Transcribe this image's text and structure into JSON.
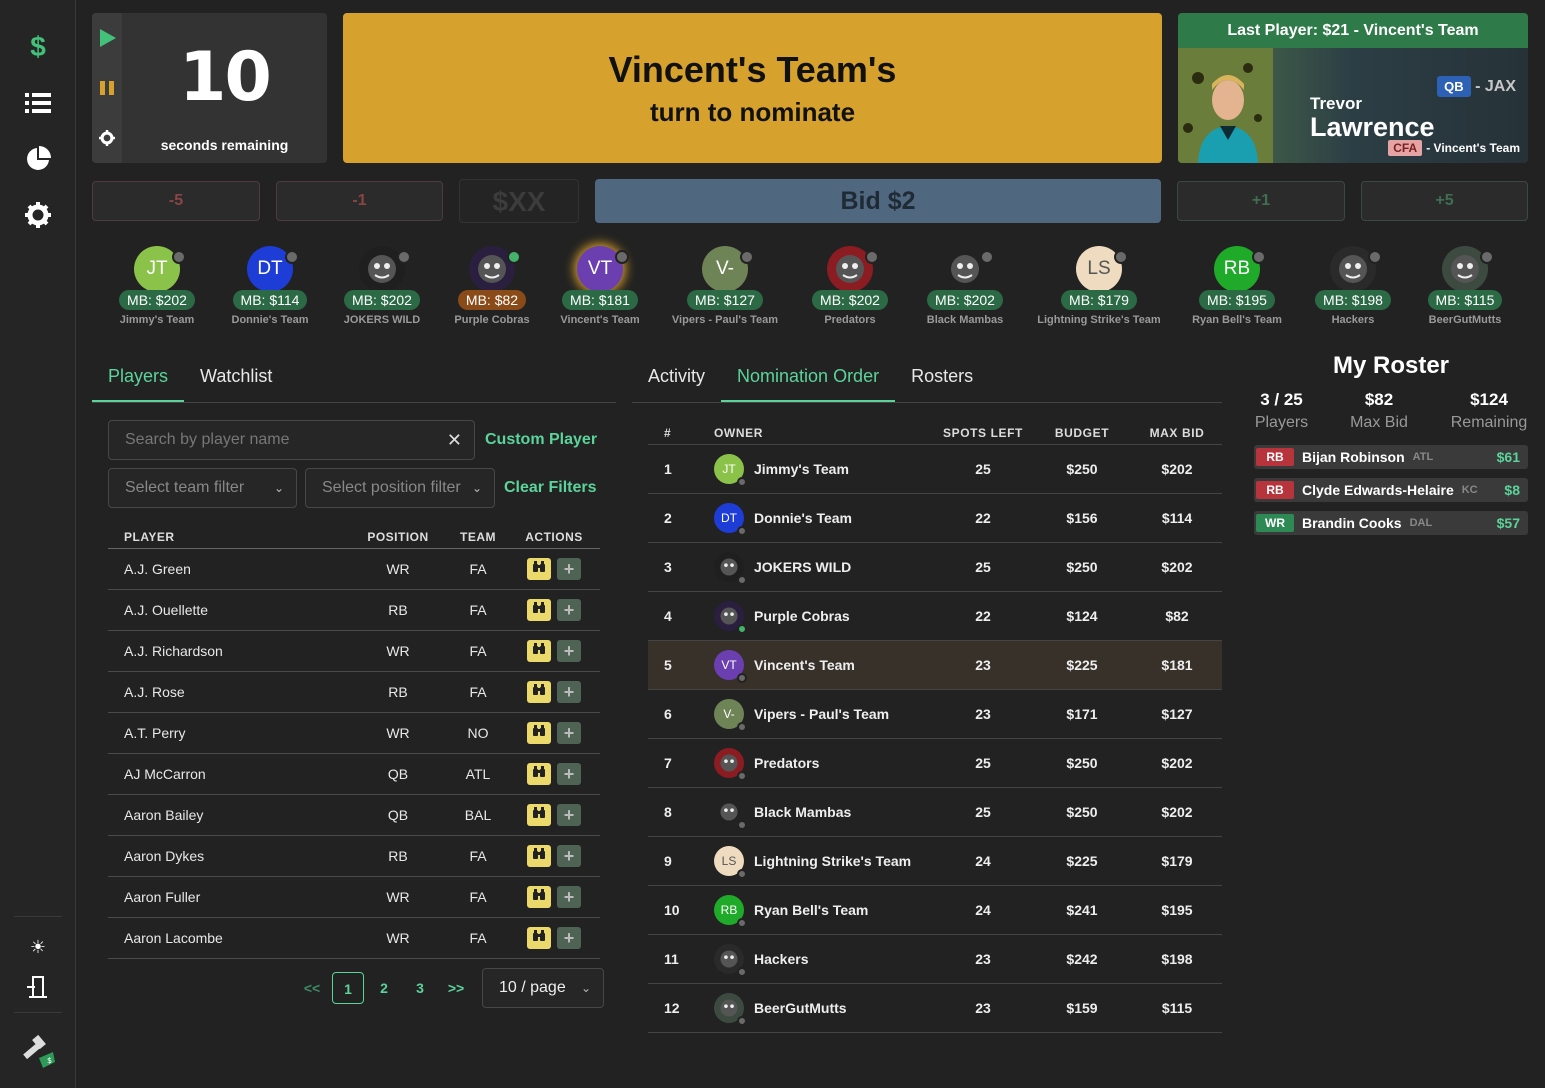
{
  "timer": {
    "value": "10",
    "label": "seconds remaining"
  },
  "banner": {
    "title": "Vincent's Team's",
    "subtitle": "turn to nominate"
  },
  "last_player": {
    "header": "Last Player: $21 - Vincent's Team",
    "position": "QB",
    "team": "- JAX",
    "first_name": "Trevor",
    "last_name": "Lawrence",
    "status": "CFA",
    "owner": "- Vincent's Team"
  },
  "bid": {
    "minus5": "-5",
    "minus1": "-1",
    "input_placeholder": "$XX",
    "main": "Bid $2",
    "plus1": "+1",
    "plus5": "+5"
  },
  "teams": [
    {
      "initials": "JT",
      "mb": "MB: $202",
      "name": "Jimmy's Team",
      "color": "#8bc34a",
      "online": false
    },
    {
      "initials": "DT",
      "mb": "MB: $114",
      "name": "Donnie's Team",
      "color": "#1e3cd6",
      "online": false
    },
    {
      "initials": "",
      "mb": "MB: $202",
      "name": "JOKERS WILD",
      "color": "#1f1f1f",
      "online": false,
      "icon": "joker-logo-icon"
    },
    {
      "initials": "",
      "mb": "MB: $82",
      "name": "Purple Cobras",
      "color": "#2a1f3f",
      "online": true,
      "warn": true,
      "icon": "cobra-logo-icon"
    },
    {
      "initials": "VT",
      "mb": "MB: $181",
      "name": "Vincent's Team",
      "color": "#6b3fb0",
      "online": false,
      "current": true
    },
    {
      "initials": "V-",
      "mb": "MB: $127",
      "name": "Vipers - Paul's Team",
      "color": "#6f8456",
      "online": false
    },
    {
      "initials": "",
      "mb": "MB: $202",
      "name": "Predators",
      "color": "#8a1c22",
      "online": false,
      "icon": "predator-logo-icon"
    },
    {
      "initials": "",
      "mb": "MB: $202",
      "name": "Black Mambas",
      "color": "#222222",
      "online": false,
      "icon": "mamba-logo-icon"
    },
    {
      "initials": "LS",
      "mb": "MB: $179",
      "name": "Lightning Strike's Team",
      "color": "#efdcc0",
      "online": false,
      "dark_text": true
    },
    {
      "initials": "RB",
      "mb": "MB: $195",
      "name": "Ryan Bell's Team",
      "color": "#1faa2a",
      "online": false
    },
    {
      "initials": "",
      "mb": "MB: $198",
      "name": "Hackers",
      "color": "#2a2a2a",
      "online": false,
      "icon": "skull-logo-icon"
    },
    {
      "initials": "",
      "mb": "MB: $115",
      "name": "BeerGutMutts",
      "color": "#3c4a40",
      "online": false,
      "icon": "bulldog-logo-icon"
    }
  ],
  "left_tabs": [
    "Players",
    "Watchlist"
  ],
  "search": {
    "placeholder": "Search by player name",
    "custom_player": "Custom Player"
  },
  "filters": {
    "team": "Select team filter",
    "position": "Select position filter",
    "clear": "Clear Filters"
  },
  "players_table": {
    "headers": [
      "PLAYER",
      "POSITION",
      "TEAM",
      "ACTIONS"
    ],
    "rows": [
      [
        "A.J. Green",
        "WR",
        "FA"
      ],
      [
        "A.J. Ouellette",
        "RB",
        "FA"
      ],
      [
        "A.J. Richardson",
        "WR",
        "FA"
      ],
      [
        "A.J. Rose",
        "RB",
        "FA"
      ],
      [
        "A.T. Perry",
        "WR",
        "NO"
      ],
      [
        "AJ McCarron",
        "QB",
        "ATL"
      ],
      [
        "Aaron Bailey",
        "QB",
        "BAL"
      ],
      [
        "Aaron Dykes",
        "RB",
        "FA"
      ],
      [
        "Aaron Fuller",
        "WR",
        "FA"
      ],
      [
        "Aaron Lacombe",
        "WR",
        "FA"
      ]
    ]
  },
  "pagination": {
    "prev": "<<",
    "pages": [
      "1",
      "2",
      "3"
    ],
    "next": ">>",
    "page_size": "10 / page"
  },
  "center_tabs": [
    "Activity",
    "Nomination Order",
    "Rosters"
  ],
  "nomination": {
    "headers": [
      "#",
      "OWNER",
      "SPOTS LEFT",
      "BUDGET",
      "MAX BID"
    ],
    "rows": [
      [
        "1",
        "Jimmy's Team",
        "25",
        "$250",
        "$202"
      ],
      [
        "2",
        "Donnie's Team",
        "22",
        "$156",
        "$114"
      ],
      [
        "3",
        "JOKERS WILD",
        "25",
        "$250",
        "$202"
      ],
      [
        "4",
        "Purple Cobras",
        "22",
        "$124",
        "$82"
      ],
      [
        "5",
        "Vincent's Team",
        "23",
        "$225",
        "$181"
      ],
      [
        "6",
        "Vipers - Paul's Team",
        "23",
        "$171",
        "$127"
      ],
      [
        "7",
        "Predators",
        "25",
        "$250",
        "$202"
      ],
      [
        "8",
        "Black Mambas",
        "25",
        "$250",
        "$202"
      ],
      [
        "9",
        "Lightning Strike's Team",
        "24",
        "$225",
        "$179"
      ],
      [
        "10",
        "Ryan Bell's Team",
        "24",
        "$241",
        "$195"
      ],
      [
        "11",
        "Hackers",
        "23",
        "$242",
        "$198"
      ],
      [
        "12",
        "BeerGutMutts",
        "23",
        "$159",
        "$115"
      ]
    ],
    "current_index": 4
  },
  "roster": {
    "title": "My Roster",
    "stats": [
      {
        "value": "3 / 25",
        "label": "Players"
      },
      {
        "value": "$82",
        "label": "Max Bid"
      },
      {
        "value": "$124",
        "label": "Remaining"
      }
    ],
    "players": [
      {
        "pos": "RB",
        "name": "Bijan Robinson",
        "team": "ATL",
        "price": "$61",
        "color": "#b8343c"
      },
      {
        "pos": "RB",
        "name": "Clyde Edwards-Helaire",
        "team": "KC",
        "price": "$8",
        "color": "#b8343c"
      },
      {
        "pos": "WR",
        "name": "Brandin Cooks",
        "team": "DAL",
        "price": "$57",
        "color": "#2e8a54"
      }
    ]
  },
  "colors": {
    "accent": "#5bd39a",
    "banner": "#d6a12c",
    "bid": "#4f6880"
  }
}
